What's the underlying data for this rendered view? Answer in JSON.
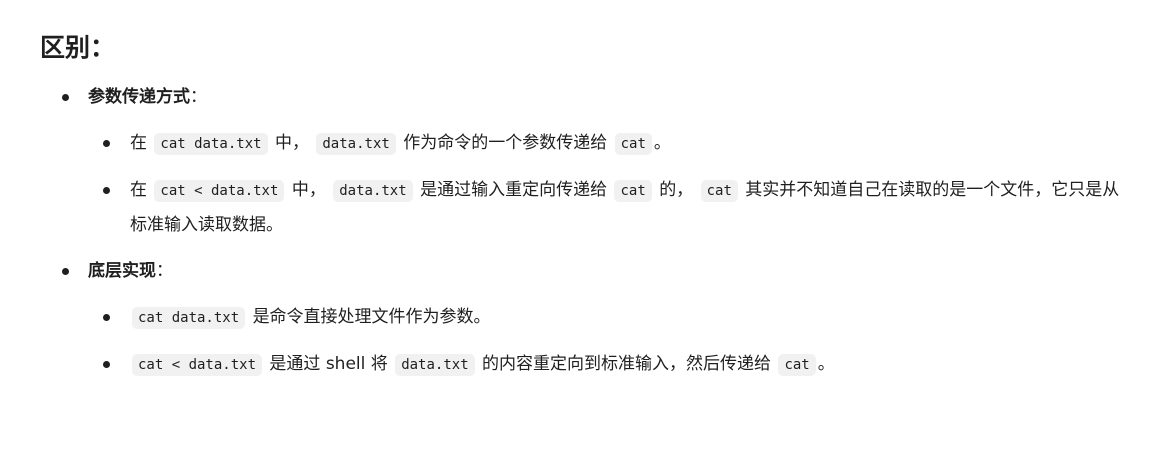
{
  "title": "区别：",
  "sections": [
    {
      "heading": "参数传递方式",
      "colon": "：",
      "items": [
        {
          "pre": "在",
          "code1": "cat data.txt",
          "mid1": "中，",
          "code2": "data.txt",
          "mid2": "作为命令的一个参数传递给",
          "code3": "cat",
          "end": "。"
        },
        {
          "pre": "在",
          "code1": "cat < data.txt",
          "mid1": "中，",
          "code2": "data.txt",
          "mid2": "是通过输入重定向传递给",
          "code3": "cat",
          "mid3": "的，",
          "code4": "cat",
          "end": "其实并不知道自己在读取的是一个文件，它只是从标准输入读取数据。"
        }
      ]
    },
    {
      "heading": "底层实现",
      "colon": "：",
      "items": [
        {
          "code1": "cat data.txt",
          "end": "是命令直接处理文件作为参数。"
        },
        {
          "code1": "cat < data.txt",
          "mid1": "是通过 shell 将",
          "code2": "data.txt",
          "mid2": "的内容重定向到标准输入，然后传递给",
          "code3": "cat",
          "end": "。"
        }
      ]
    }
  ]
}
